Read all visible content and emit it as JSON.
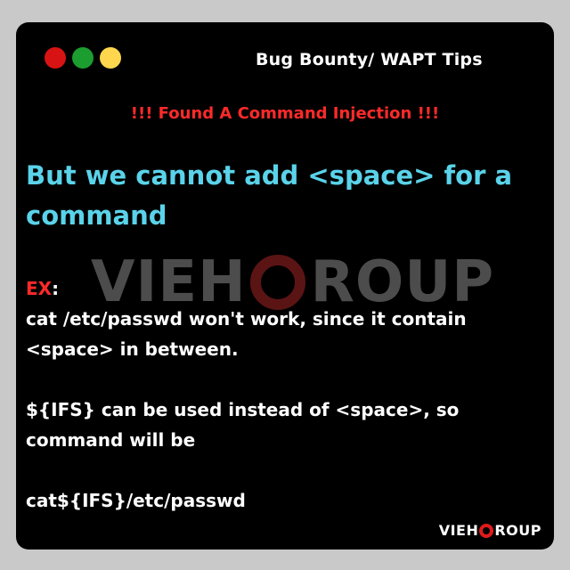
{
  "header": {
    "title": "Bug Bounty/ WAPT Tips"
  },
  "alert_text": "!!! Found A Command Injection !!!",
  "headline": "But we cannot add <space> for a command",
  "body": {
    "ex_label": "EX",
    "ex_colon": ":",
    "line1": "cat /etc/passwd won't work, since it contain",
    "line2": "<space> in between.",
    "line3": "${IFS} can be used instead of <space>, so",
    "line4": "command will be",
    "line5": "cat${IFS}/etc/passwd"
  },
  "watermark": {
    "left": "VIEH",
    "right": "ROUP"
  },
  "logo": {
    "left": "VIEH",
    "right": "ROUP"
  },
  "colors": {
    "window_bg": "#000000",
    "traffic_red": "#d81313",
    "traffic_green": "#1c9d2f",
    "traffic_yellow": "#ffd64d",
    "alert": "#ff2a2a",
    "headline": "#5ad3ea",
    "text": "#ffffff"
  },
  "icons": {
    "window_controls": [
      "close-dot",
      "maximize-dot",
      "minimize-dot"
    ],
    "logo_mark": "g-ring-logo"
  }
}
